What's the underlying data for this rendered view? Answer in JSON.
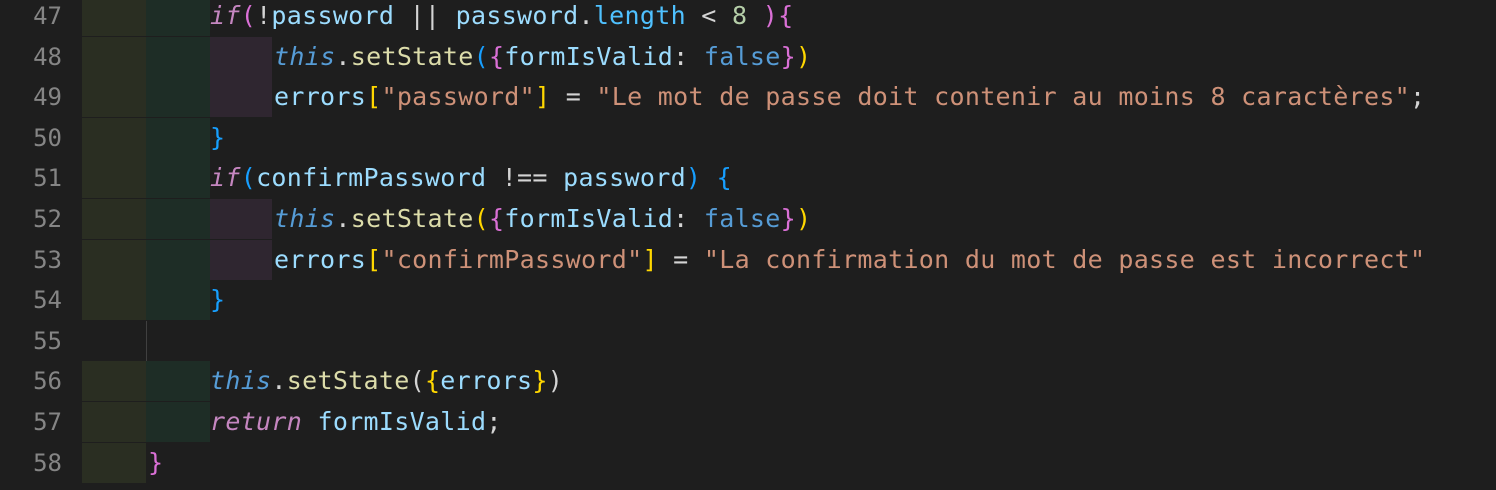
{
  "editor": {
    "language": "javascript",
    "theme_colors": {
      "background": "#1e1e1e",
      "line_number": "#858585",
      "indent_level_1": "#2a2e22",
      "indent_level_2": "#1e2d26",
      "indent_level_3": "#2f2630"
    },
    "lines": [
      {
        "number": "47",
        "indent": 3,
        "tokens": [
          {
            "t": "if",
            "c": "kw"
          },
          {
            "t": "(",
            "c": "b2"
          },
          {
            "t": "!",
            "c": "op"
          },
          {
            "t": "password",
            "c": "var"
          },
          {
            "t": " || ",
            "c": "op"
          },
          {
            "t": "password",
            "c": "var"
          },
          {
            "t": ".",
            "c": "op"
          },
          {
            "t": "length",
            "c": "prop"
          },
          {
            "t": " < ",
            "c": "op"
          },
          {
            "t": "8",
            "c": "num"
          },
          {
            "t": " ",
            "c": "op"
          },
          {
            "t": ")",
            "c": "b2"
          },
          {
            "t": "{",
            "c": "b2"
          }
        ]
      },
      {
        "number": "48",
        "indent": 4,
        "tokens": [
          {
            "t": "this",
            "c": "this"
          },
          {
            "t": ".",
            "c": "op"
          },
          {
            "t": "setState",
            "c": "fn"
          },
          {
            "t": "(",
            "c": "b3"
          },
          {
            "t": "{",
            "c": "b2"
          },
          {
            "t": "formIsValid",
            "c": "var"
          },
          {
            "t": ": ",
            "c": "op"
          },
          {
            "t": "false",
            "c": "const"
          },
          {
            "t": "}",
            "c": "b2"
          },
          {
            "t": ")",
            "c": "b1"
          }
        ]
      },
      {
        "number": "49",
        "indent": 4,
        "tokens": [
          {
            "t": "errors",
            "c": "var"
          },
          {
            "t": "[",
            "c": "b1"
          },
          {
            "t": "\"password\"",
            "c": "str"
          },
          {
            "t": "]",
            "c": "b1"
          },
          {
            "t": " = ",
            "c": "op"
          },
          {
            "t": "\"Le mot de passe doit contenir au moins 8 caractères\"",
            "c": "str"
          },
          {
            "t": ";",
            "c": "op"
          }
        ]
      },
      {
        "number": "50",
        "indent": 3,
        "tokens": [
          {
            "t": "}",
            "c": "b3"
          }
        ]
      },
      {
        "number": "51",
        "indent": 3,
        "tokens": [
          {
            "t": "if",
            "c": "kw"
          },
          {
            "t": "(",
            "c": "b3"
          },
          {
            "t": "confirmPassword",
            "c": "var"
          },
          {
            "t": " !== ",
            "c": "op"
          },
          {
            "t": "password",
            "c": "var"
          },
          {
            "t": ")",
            "c": "b3"
          },
          {
            "t": " ",
            "c": "op"
          },
          {
            "t": "{",
            "c": "b3"
          }
        ]
      },
      {
        "number": "52",
        "indent": 4,
        "tokens": [
          {
            "t": "this",
            "c": "this"
          },
          {
            "t": ".",
            "c": "op"
          },
          {
            "t": "setState",
            "c": "fn"
          },
          {
            "t": "(",
            "c": "b1"
          },
          {
            "t": "{",
            "c": "b2"
          },
          {
            "t": "formIsValid",
            "c": "var"
          },
          {
            "t": ": ",
            "c": "op"
          },
          {
            "t": "false",
            "c": "const"
          },
          {
            "t": "}",
            "c": "b2"
          },
          {
            "t": ")",
            "c": "b1"
          }
        ]
      },
      {
        "number": "53",
        "indent": 4,
        "tokens": [
          {
            "t": "errors",
            "c": "var"
          },
          {
            "t": "[",
            "c": "b1"
          },
          {
            "t": "\"confirmPassword\"",
            "c": "str"
          },
          {
            "t": "]",
            "c": "b1"
          },
          {
            "t": " = ",
            "c": "op"
          },
          {
            "t": "\"La confirmation du mot de passe est incorrect\"",
            "c": "str"
          }
        ]
      },
      {
        "number": "54",
        "indent": 3,
        "tokens": [
          {
            "t": "}",
            "c": "b3"
          }
        ]
      },
      {
        "number": "55",
        "indent": 0,
        "tokens": []
      },
      {
        "number": "56",
        "indent": 3,
        "tokens": [
          {
            "t": "this",
            "c": "this"
          },
          {
            "t": ".",
            "c": "op"
          },
          {
            "t": "setState",
            "c": "fn"
          },
          {
            "t": "(",
            "c": "op"
          },
          {
            "t": "{",
            "c": "b1"
          },
          {
            "t": "errors",
            "c": "var"
          },
          {
            "t": "}",
            "c": "b1"
          },
          {
            "t": ")",
            "c": "op"
          }
        ]
      },
      {
        "number": "57",
        "indent": 3,
        "tokens": [
          {
            "t": "return",
            "c": "kw"
          },
          {
            "t": " ",
            "c": "op"
          },
          {
            "t": "formIsValid",
            "c": "var"
          },
          {
            "t": ";",
            "c": "op"
          }
        ]
      },
      {
        "number": "58",
        "indent": 2,
        "tokens": [
          {
            "t": "}",
            "c": "b2"
          }
        ]
      }
    ]
  }
}
